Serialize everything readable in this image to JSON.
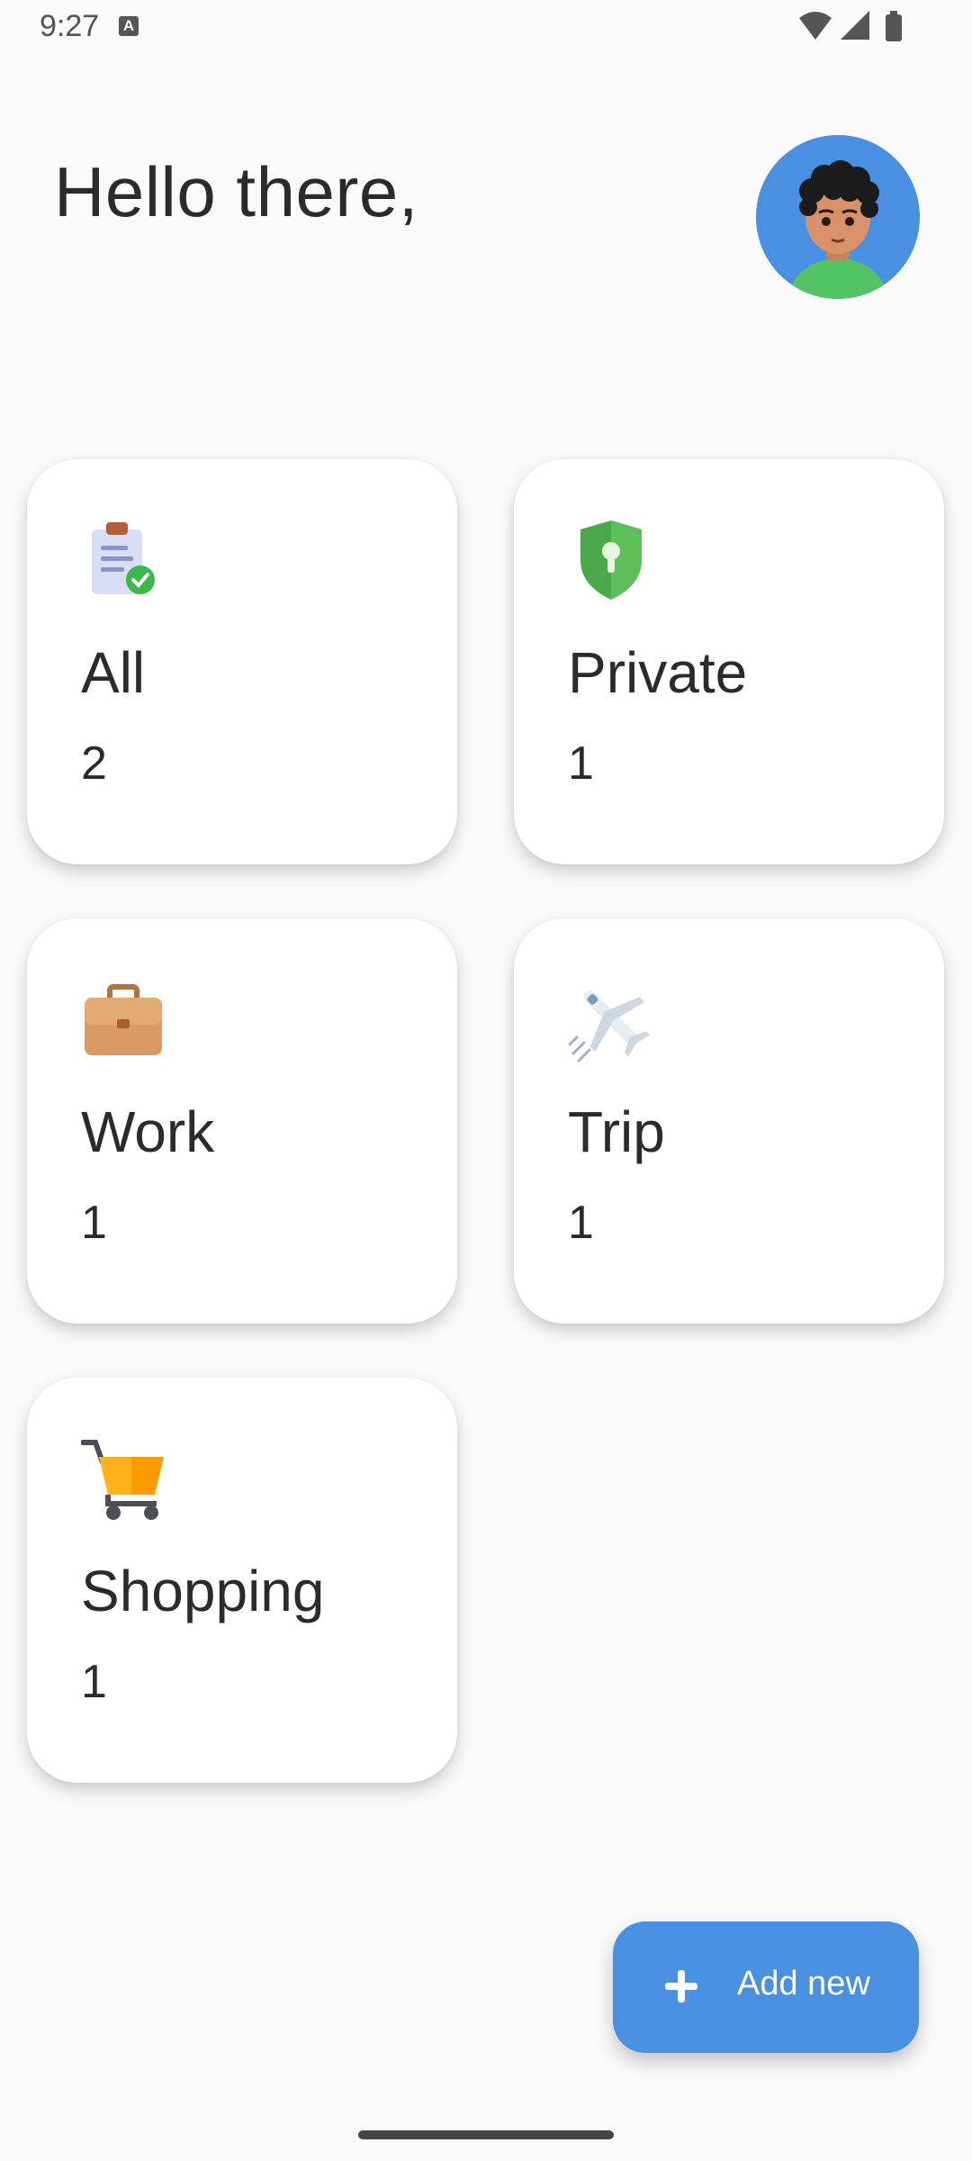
{
  "status_bar": {
    "time": "9:27",
    "notification_icon": "A",
    "icons": [
      "wifi-icon",
      "signal-icon",
      "battery-icon"
    ]
  },
  "header": {
    "greeting": "Hello there,",
    "avatar_icon": "user-avatar"
  },
  "categories": [
    {
      "label": "All",
      "count": "2",
      "icon": "clipboard-check-icon"
    },
    {
      "label": "Private",
      "count": "1",
      "icon": "shield-lock-icon"
    },
    {
      "label": "Work",
      "count": "1",
      "icon": "briefcase-icon"
    },
    {
      "label": "Trip",
      "count": "1",
      "icon": "airplane-icon"
    },
    {
      "label": "Shopping",
      "count": "1",
      "icon": "shopping-cart-icon"
    }
  ],
  "fab": {
    "label": "Add new",
    "icon": "plus-icon"
  },
  "colors": {
    "background": "#fafafa",
    "card": "#ffffff",
    "accent": "#4a90e2",
    "text": "#2b2b2b"
  }
}
